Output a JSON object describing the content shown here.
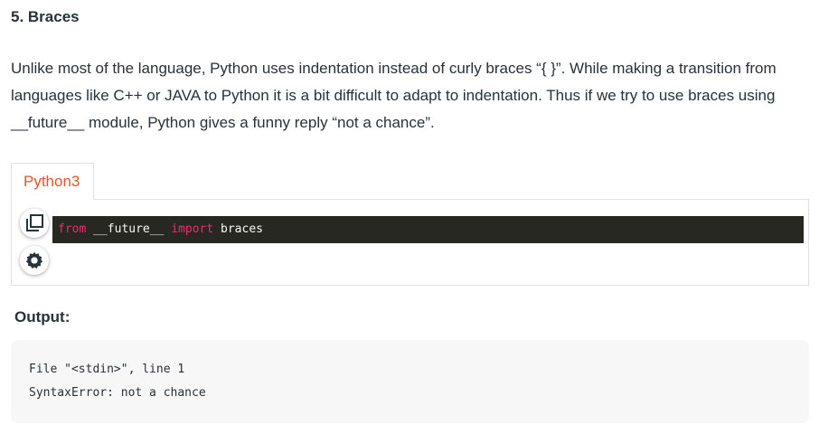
{
  "section": {
    "heading": "5. Braces",
    "paragraph": "Unlike most of the language, Python uses indentation instead of curly braces “{ }”. While making a transition from languages like C++ or JAVA to Python it is a bit difficult to adapt to indentation. Thus if we try to use braces using __future__ module, Python gives a funny reply “not a chance”."
  },
  "code_tab": {
    "label": "Python3",
    "label_color": "#e4562b"
  },
  "code": {
    "tokens": [
      "from",
      " __future__ ",
      "import",
      " braces"
    ],
    "keyword_color": "#f92672",
    "background": "#272822"
  },
  "icons": {
    "copy": "copy-icon",
    "settings": "gear-icon"
  },
  "output": {
    "label": "Output:",
    "lines": [
      "File \"<stdin>\", line 1",
      "SyntaxError: not a chance"
    ]
  }
}
